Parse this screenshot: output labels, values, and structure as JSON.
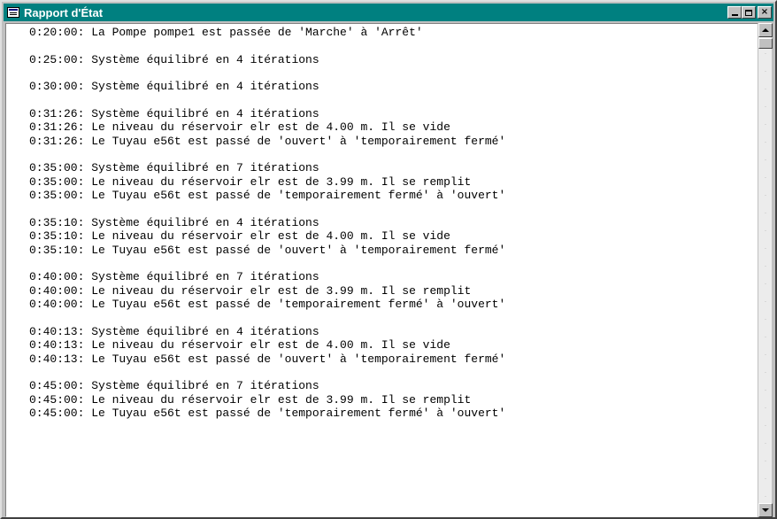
{
  "window": {
    "title": "Rapport d'État",
    "buttons": {
      "minimize": "_",
      "maximize": "□",
      "close": "×"
    }
  },
  "log": [
    [
      "0:20:00: La Pompe pompe1 est passée de 'Marche' à 'Arrêt'"
    ],
    [
      "0:25:00: Système équilibré en 4 itérations"
    ],
    [
      "0:30:00: Système équilibré en 4 itérations"
    ],
    [
      "0:31:26: Système équilibré en 4 itérations",
      "0:31:26: Le niveau du réservoir elr est de 4.00 m. Il se vide",
      "0:31:26: Le Tuyau e56t est passé de 'ouvert' à 'temporairement fermé'"
    ],
    [
      "0:35:00: Système équilibré en 7 itérations",
      "0:35:00: Le niveau du réservoir elr est de 3.99 m. Il se remplit",
      "0:35:00: Le Tuyau e56t est passé de 'temporairement fermé' à 'ouvert'"
    ],
    [
      "0:35:10: Système équilibré en 4 itérations",
      "0:35:10: Le niveau du réservoir elr est de 4.00 m. Il se vide",
      "0:35:10: Le Tuyau e56t est passé de 'ouvert' à 'temporairement fermé'"
    ],
    [
      "0:40:00: Système équilibré en 7 itérations",
      "0:40:00: Le niveau du réservoir elr est de 3.99 m. Il se remplit",
      "0:40:00: Le Tuyau e56t est passé de 'temporairement fermé' à 'ouvert'"
    ],
    [
      "0:40:13: Système équilibré en 4 itérations",
      "0:40:13: Le niveau du réservoir elr est de 4.00 m. Il se vide",
      "0:40:13: Le Tuyau e56t est passé de 'ouvert' à 'temporairement fermé'"
    ],
    [
      "0:45:00: Système équilibré en 7 itérations",
      "0:45:00: Le niveau du réservoir elr est de 3.99 m. Il se remplit",
      "0:45:00: Le Tuyau e56t est passé de 'temporairement fermé' à 'ouvert'"
    ]
  ],
  "colors": {
    "titlebar": "#008080",
    "window": "#c0c0c0",
    "content": "#ffffff"
  }
}
